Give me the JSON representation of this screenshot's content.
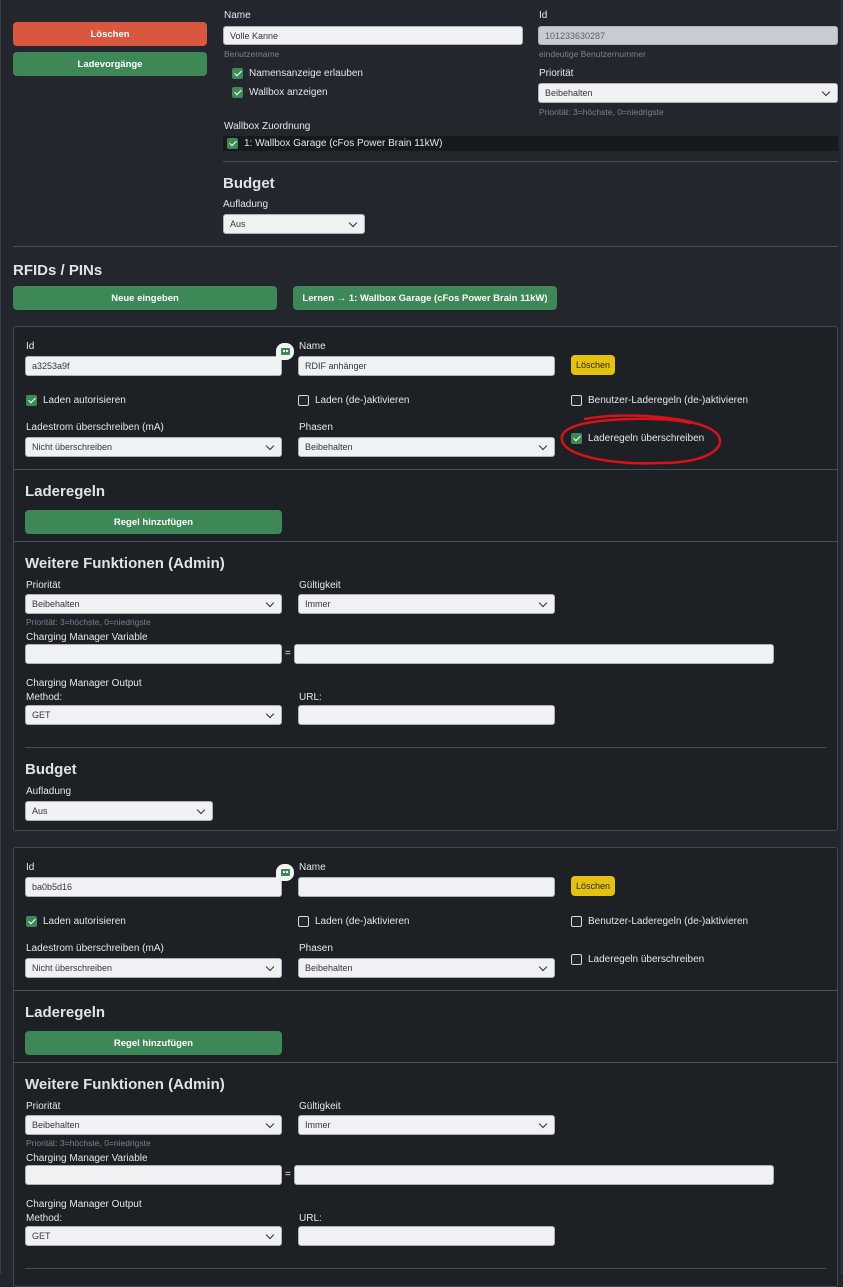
{
  "top": {
    "buttons": {
      "delete": "Löschen",
      "sessions": "Ladevorgänge"
    },
    "name": {
      "label": "Name",
      "value": "Volle Kanne",
      "hint": "Benutzername"
    },
    "id": {
      "label": "Id",
      "value": "101233630287",
      "hint": "eindeutige Benutzernummer"
    },
    "show_name": "Namensanzeige erlauben",
    "show_wallbox": "Wallbox anzeigen",
    "priority": {
      "label": "Priorität",
      "value": "Beibehalten",
      "hint": "Priorität: 3=höchste, 0=niedrigste"
    },
    "wallbox_assign": {
      "label": "Wallbox Zuordnung",
      "item": "1: Wallbox Garage (cFos Power Brain 11kW)"
    },
    "budget": {
      "title": "Budget",
      "label": "Aufladung",
      "value": "Aus"
    }
  },
  "rfids": {
    "title": "RFIDs / PINs",
    "new_button": "Neue eingeben",
    "learn_button": "Lernen → 1: Wallbox Garage (cFos Power Brain 11kW)"
  },
  "cards": [
    {
      "id_label": "Id",
      "id_value": "a3253a9f",
      "name_label": "Name",
      "name_value": "RDIF anhänger",
      "delete": "Löschen",
      "authorize": "Laden autorisieren",
      "activate": "Laden (de-)aktivieren",
      "user_rules": "Benutzer-Laderegeln (de-)aktivieren",
      "current_label": "Ladestrom überschreiben (mA)",
      "current_value": "Nicht überschreiben",
      "phases_label": "Phasen",
      "phases_value": "Beibehalten",
      "override_rules": "Laderegeln überschreiben",
      "rules_title": "Laderegeln",
      "add_rule": "Regel hinzufügen",
      "admin_title": "Weitere Funktionen (Admin)",
      "prio_label": "Priorität",
      "prio_value": "Beibehalten",
      "prio_hint": "Priorität: 3=höchste, 0=niedrigste",
      "valid_label": "Gültigkeit",
      "valid_value": "Immer",
      "cmv_label": "Charging Manager Variable",
      "eq": "=",
      "cmo_label": "Charging Manager Output",
      "method_label": "Method:",
      "method_value": "GET",
      "url_label": "URL:",
      "budget_title": "Budget",
      "budget_label": "Aufladung",
      "budget_value": "Aus"
    },
    {
      "id_label": "Id",
      "id_value": "ba0b5d16",
      "name_label": "Name",
      "name_value": "",
      "delete": "Löschen",
      "authorize": "Laden autorisieren",
      "activate": "Laden (de-)aktivieren",
      "user_rules": "Benutzer-Laderegeln (de-)aktivieren",
      "current_label": "Ladestrom überschreiben (mA)",
      "current_value": "Nicht überschreiben",
      "phases_label": "Phasen",
      "phases_value": "Beibehalten",
      "override_rules": "Laderegeln überschreiben",
      "rules_title": "Laderegeln",
      "add_rule": "Regel hinzufügen",
      "admin_title": "Weitere Funktionen (Admin)",
      "prio_label": "Priorität",
      "prio_value": "Beibehalten",
      "prio_hint": "Priorität: 3=höchste, 0=niedrigste",
      "valid_label": "Gültigkeit",
      "valid_value": "Immer",
      "cmv_label": "Charging Manager Variable",
      "eq": "=",
      "cmo_label": "Charging Manager Output",
      "method_label": "Method:",
      "method_value": "GET",
      "url_label": "URL:"
    }
  ],
  "colors": {
    "bg": "#23262d",
    "card": "#1d2025",
    "green": "#3e8757",
    "red": "#d9573f",
    "yellow": "#e4c00f",
    "annotation": "#d8121a"
  }
}
